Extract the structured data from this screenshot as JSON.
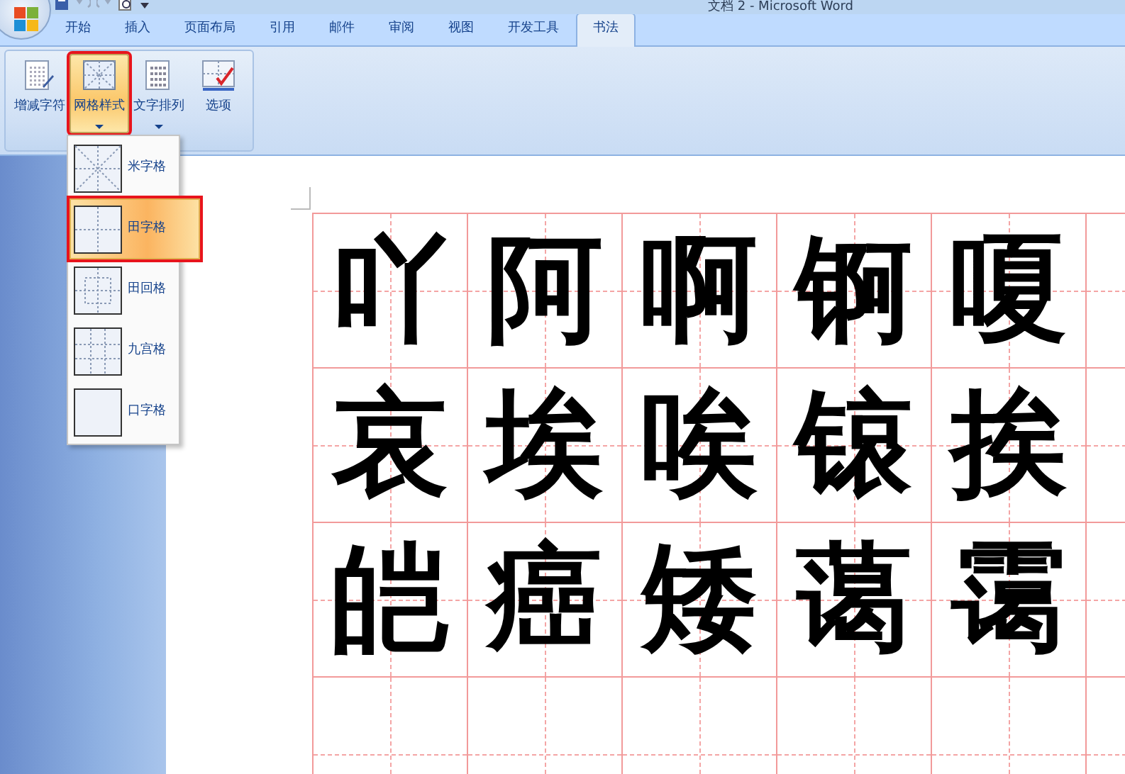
{
  "window": {
    "title": "文档 2 - Microsoft Word"
  },
  "tabs": [
    {
      "label": "开始",
      "selected": false
    },
    {
      "label": "插入",
      "selected": false
    },
    {
      "label": "页面布局",
      "selected": false
    },
    {
      "label": "引用",
      "selected": false
    },
    {
      "label": "邮件",
      "selected": false
    },
    {
      "label": "审阅",
      "selected": false
    },
    {
      "label": "视图",
      "selected": false
    },
    {
      "label": "开发工具",
      "selected": false
    },
    {
      "label": "书法",
      "selected": true
    }
  ],
  "ribbon": {
    "buttons": [
      {
        "label": "增减字符",
        "kind": "plain",
        "pressed": false,
        "highlighted": false
      },
      {
        "label": "网格样式",
        "kind": "dropdown",
        "pressed": true,
        "highlighted": true
      },
      {
        "label": "文字排列",
        "kind": "dropdown",
        "pressed": false,
        "highlighted": false
      },
      {
        "label": "选项",
        "kind": "plain",
        "pressed": false,
        "highlighted": false
      }
    ]
  },
  "grid_menu": {
    "items": [
      {
        "label": "米字格",
        "kind": "mi",
        "selected": false,
        "highlighted": false
      },
      {
        "label": "田字格",
        "kind": "tian",
        "selected": true,
        "highlighted": true
      },
      {
        "label": "田回格",
        "kind": "hui",
        "selected": false,
        "highlighted": false
      },
      {
        "label": "九宫格",
        "kind": "nine",
        "selected": false,
        "highlighted": false
      },
      {
        "label": "口字格",
        "kind": "kou",
        "selected": false,
        "highlighted": false
      }
    ]
  },
  "document": {
    "rows": [
      [
        "吖",
        "阿",
        "啊",
        "锕",
        "嗄"
      ],
      [
        "哀",
        "埃",
        "唉",
        "锿",
        "挨"
      ],
      [
        "皑",
        "癌",
        "矮",
        "蔼",
        "霭"
      ]
    ]
  }
}
